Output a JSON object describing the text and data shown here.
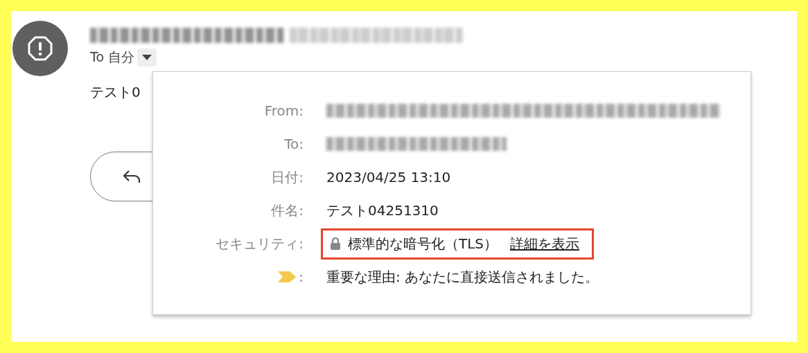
{
  "message": {
    "to_label": "To 自分",
    "body_preview": "テスト0"
  },
  "details": {
    "rows": [
      {
        "kind": "redacted",
        "label": "From:"
      },
      {
        "kind": "redacted",
        "label": "To:"
      },
      {
        "kind": "text",
        "label": "日付:",
        "value": "2023/04/25 13:10"
      },
      {
        "kind": "text",
        "label": "件名:",
        "value": "テスト04251310"
      },
      {
        "kind": "security",
        "label": "セキュリティ:",
        "value": "標準的な暗号化（TLS）",
        "link": "詳細を表示",
        "highlighted": true
      },
      {
        "kind": "importance",
        "label": ":",
        "value": "重要な理由: あなたに直接送信されました。"
      }
    ]
  }
}
